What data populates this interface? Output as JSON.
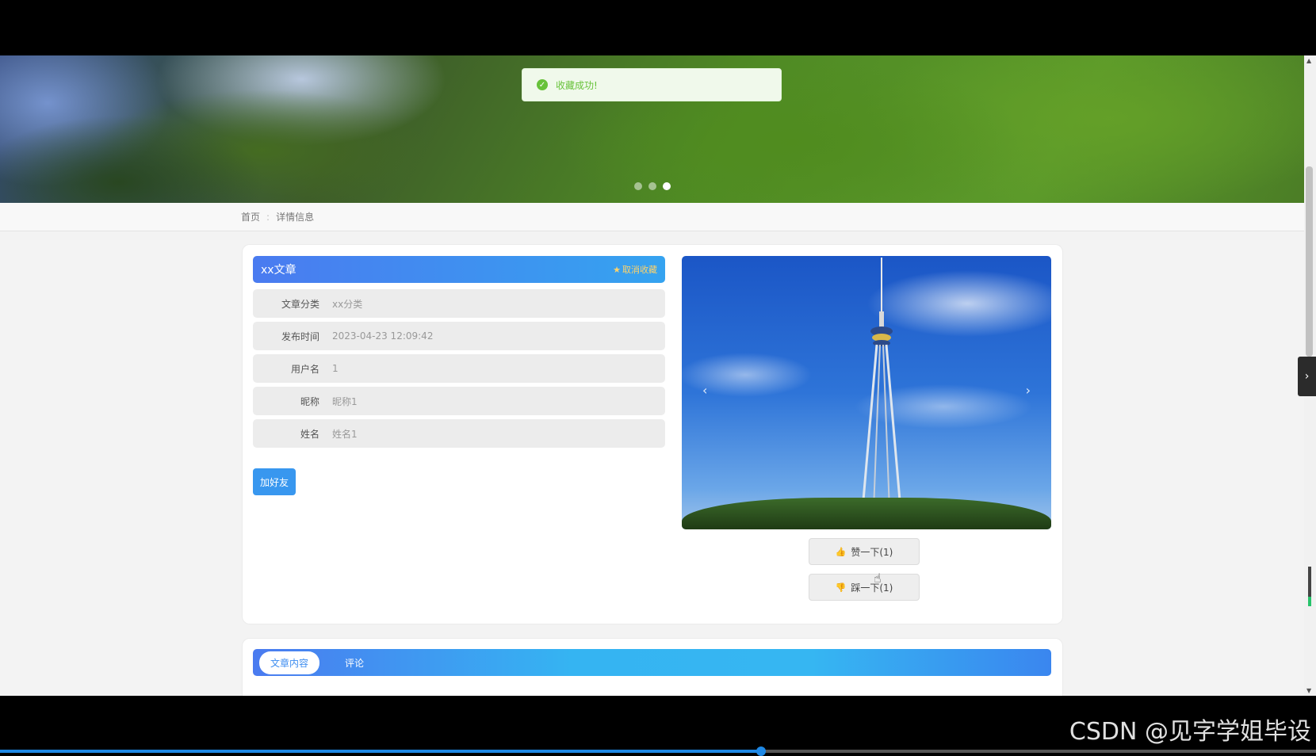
{
  "toast": {
    "message": "收藏成功!"
  },
  "banner": {
    "slides": 3,
    "active_slide": 3
  },
  "breadcrumb": {
    "home": "首页",
    "separator": ":",
    "current": "详情信息"
  },
  "article": {
    "title": "xx文章",
    "favorite_label": "取消收藏",
    "fields": [
      {
        "label": "文章分类",
        "value": "xx分类"
      },
      {
        "label": "发布时间",
        "value": "2023-04-23 12:09:42"
      },
      {
        "label": "用户名",
        "value": "1"
      },
      {
        "label": "昵称",
        "value": "昵称1"
      },
      {
        "label": "姓名",
        "value": "姓名1"
      }
    ],
    "add_friend_label": "加好友"
  },
  "gallery": {
    "prev_icon": "chevron-left-icon",
    "next_icon": "chevron-right-icon"
  },
  "votes": {
    "like_label": "赞一下(1)",
    "dislike_label": "踩一下(1)"
  },
  "tabs": [
    {
      "label": "文章内容",
      "active": true
    },
    {
      "label": "评论",
      "active": false
    }
  ],
  "watermark": "CSDN @见字学姐毕设",
  "colors": {
    "primary": "#4a7bf0",
    "accent": "#35a3f0",
    "success": "#67c23a",
    "favorite": "#ffd36a"
  }
}
